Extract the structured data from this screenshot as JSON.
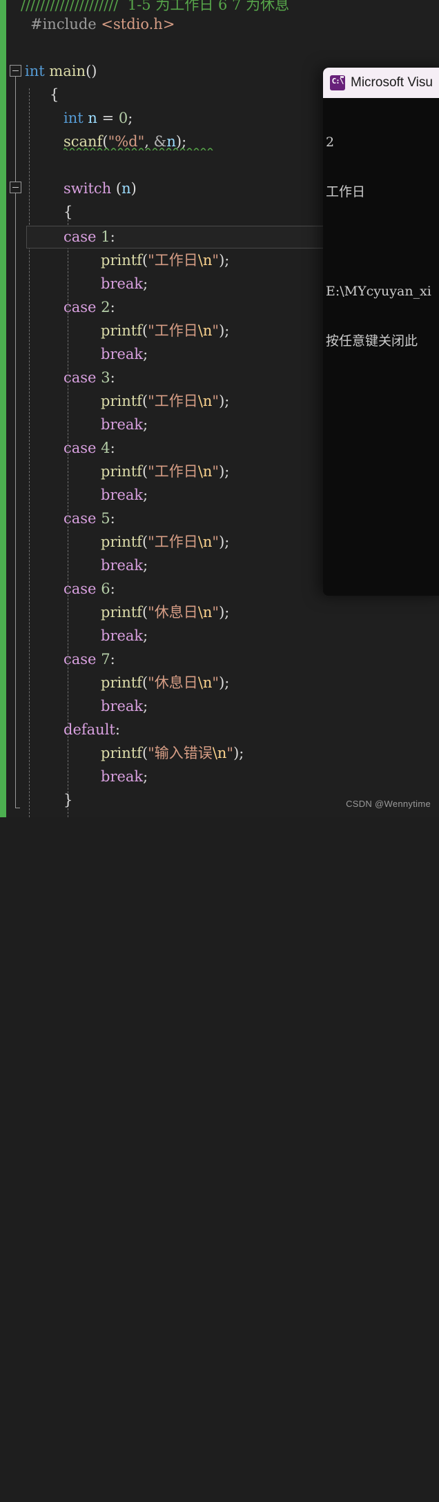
{
  "editor": {
    "background": "#1f1f1f",
    "change_bar_color": "#4caf50",
    "current_line": "case 1:",
    "lines": [
      {
        "indent": 0,
        "text": "////////////////////  1-5 为工作日 6 7 为休息",
        "kind": "comment"
      },
      {
        "indent": 0,
        "text": "#include <stdio.h>",
        "kind": "include"
      },
      {
        "indent": 0,
        "text": "",
        "kind": "blank"
      },
      {
        "indent": 0,
        "text": "int main()",
        "kind": "code"
      },
      {
        "indent": 1,
        "text": "{",
        "kind": "brace"
      },
      {
        "indent": 2,
        "text": "",
        "kind": "blank"
      },
      {
        "indent": 2,
        "text": "int n = 0;",
        "kind": "code"
      },
      {
        "indent": 2,
        "text": "scanf(\"%d\", &n);",
        "kind": "code"
      },
      {
        "indent": 2,
        "text": "",
        "kind": "blank"
      },
      {
        "indent": 2,
        "text": "switch (n)",
        "kind": "code"
      },
      {
        "indent": 2,
        "text": "{",
        "kind": "brace"
      },
      {
        "indent": 2,
        "text": "case 1:",
        "kind": "case"
      },
      {
        "indent": 3,
        "text": "printf(\"工作日\\n\");",
        "kind": "code"
      },
      {
        "indent": 3,
        "text": "break;",
        "kind": "code"
      },
      {
        "indent": 2,
        "text": "case 2:",
        "kind": "case"
      },
      {
        "indent": 3,
        "text": "printf(\"工作日\\n\");",
        "kind": "code"
      },
      {
        "indent": 3,
        "text": "break;",
        "kind": "code"
      },
      {
        "indent": 2,
        "text": "case 3:",
        "kind": "case"
      },
      {
        "indent": 3,
        "text": "printf(\"工作日\\n\");",
        "kind": "code"
      },
      {
        "indent": 3,
        "text": "break;",
        "kind": "code"
      },
      {
        "indent": 2,
        "text": "case 4:",
        "kind": "case"
      },
      {
        "indent": 3,
        "text": "printf(\"工作日\\n\");",
        "kind": "code"
      },
      {
        "indent": 3,
        "text": "break;",
        "kind": "code"
      },
      {
        "indent": 2,
        "text": "case 5:",
        "kind": "case"
      },
      {
        "indent": 3,
        "text": "printf(\"工作日\\n\");",
        "kind": "code"
      },
      {
        "indent": 3,
        "text": "break;",
        "kind": "code"
      },
      {
        "indent": 2,
        "text": "case 6:",
        "kind": "case"
      },
      {
        "indent": 3,
        "text": "printf(\"休息日\\n\");",
        "kind": "code"
      },
      {
        "indent": 3,
        "text": "break;",
        "kind": "code"
      },
      {
        "indent": 2,
        "text": "case 7:",
        "kind": "case"
      },
      {
        "indent": 3,
        "text": "printf(\"休息日\\n\");",
        "kind": "code"
      },
      {
        "indent": 3,
        "text": "break;",
        "kind": "code"
      },
      {
        "indent": 2,
        "text": "default:",
        "kind": "case"
      },
      {
        "indent": 3,
        "text": "printf(\"输入错误\\n\");",
        "kind": "code"
      },
      {
        "indent": 3,
        "text": "break;",
        "kind": "code"
      },
      {
        "indent": 2,
        "text": "}",
        "kind": "brace"
      }
    ]
  },
  "console": {
    "title": "Microsoft Visu",
    "icon": "console-window-icon",
    "icon_glyph": "C:\\",
    "output_lines": [
      "2",
      "工作日",
      "",
      "E:\\MYcyuyan_xi",
      "按任意键关闭此"
    ]
  },
  "watermark": {
    "text": "CSDN @Wennytime"
  }
}
